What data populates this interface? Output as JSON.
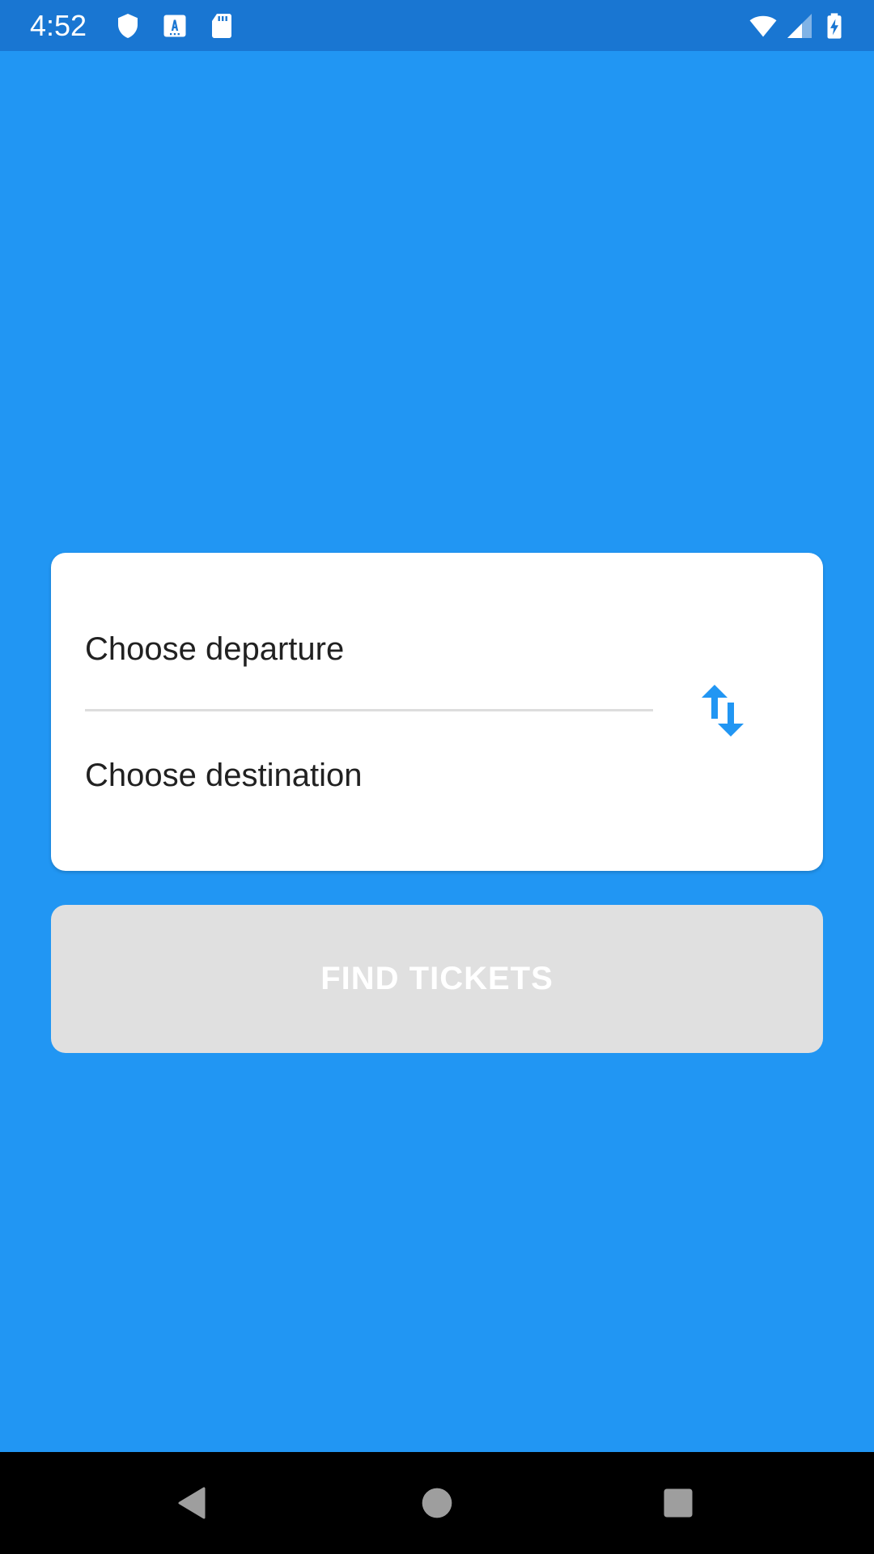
{
  "status_bar": {
    "time": "4:52",
    "icons_left": [
      "shield-icon",
      "font-download-icon",
      "sd-card-icon"
    ],
    "icons_right": [
      "wifi-icon",
      "cellular-signal-icon",
      "battery-charging-icon"
    ]
  },
  "route_card": {
    "departure_label": "Choose departure",
    "destination_label": "Choose destination",
    "swap_icon": "swap-vertical-icon"
  },
  "actions": {
    "find_tickets_label": "FIND TICKETS"
  },
  "nav_bar": {
    "icons": [
      "back-icon",
      "home-icon",
      "recents-icon"
    ]
  },
  "colors": {
    "background": "#2196F3",
    "status_bar": "#1976D2",
    "card": "#FFFFFF",
    "accent": "#2196F3",
    "button_disabled": "#E0E0E0",
    "text_primary": "#212121"
  }
}
